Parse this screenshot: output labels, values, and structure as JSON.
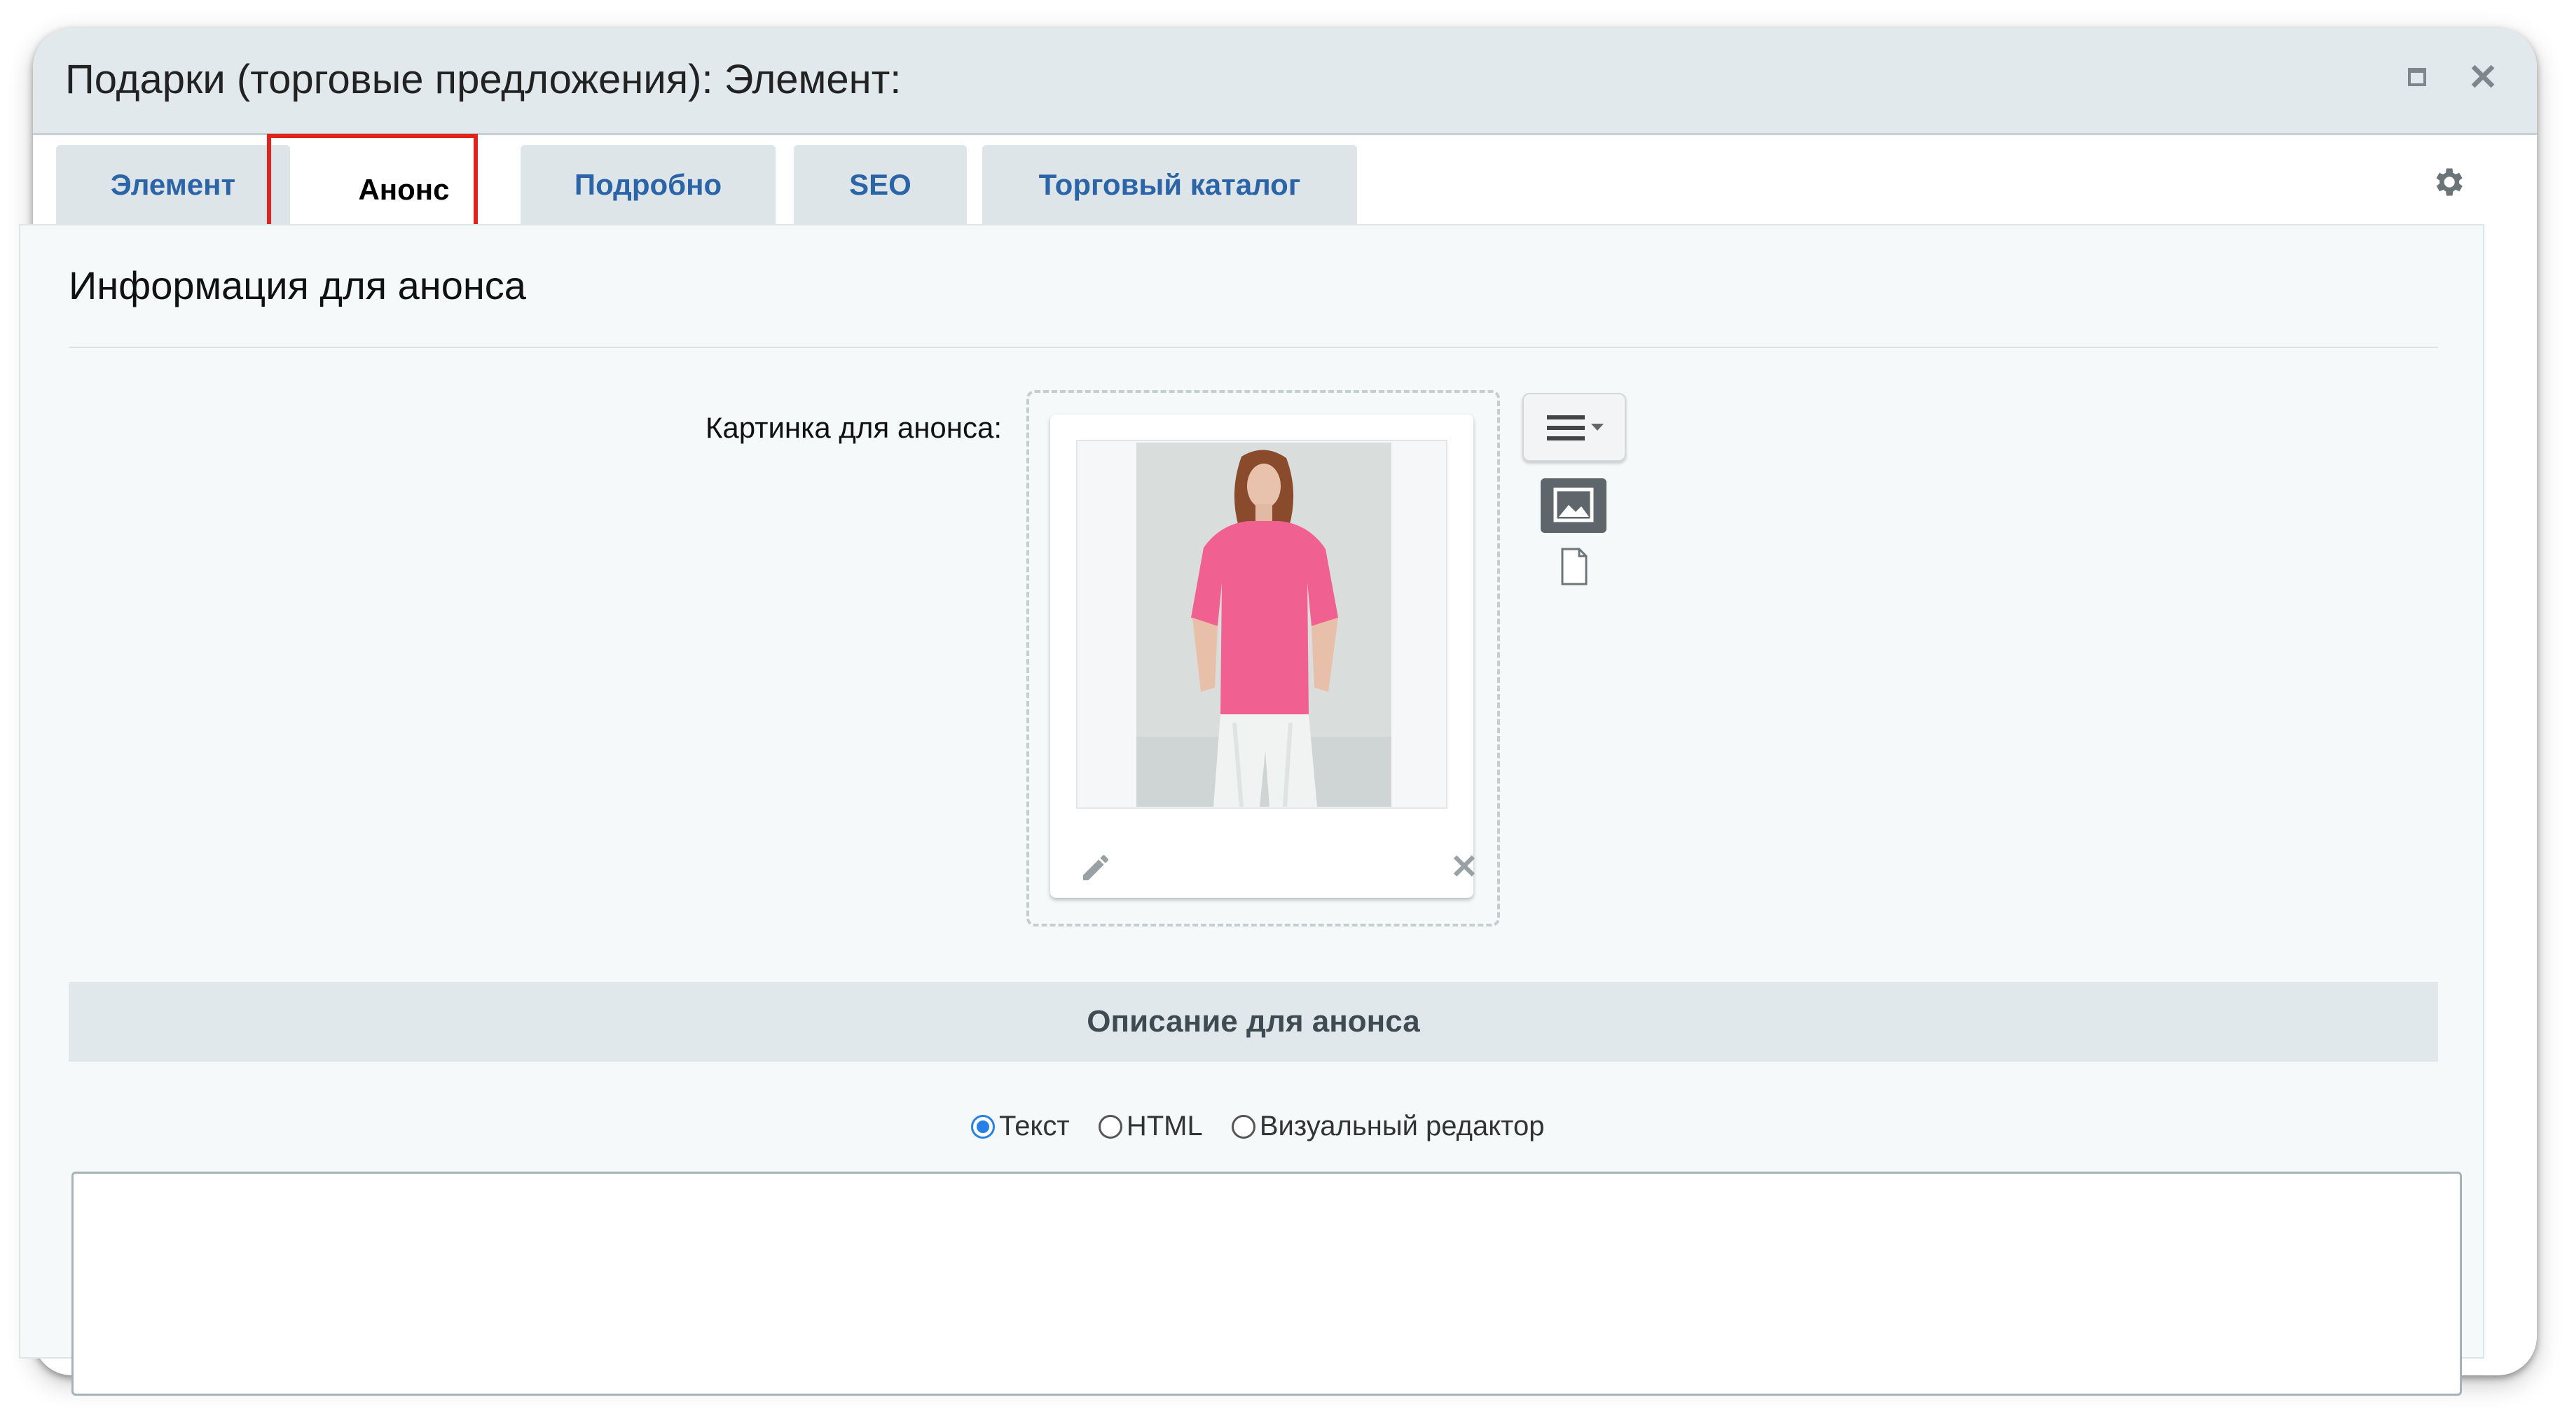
{
  "window": {
    "title": "Подарки (торговые предложения): Элемент:",
    "maximize_icon": "maximize-icon",
    "close_icon": "close-icon",
    "close_glyph": "✕"
  },
  "tabs": [
    {
      "label": "Элемент",
      "active": false
    },
    {
      "label": "Анонс",
      "active": true
    },
    {
      "label": "Подробно",
      "active": false
    },
    {
      "label": "SEO",
      "active": false
    },
    {
      "label": "Торговый каталог",
      "active": false
    }
  ],
  "settings_icon": "gear-icon",
  "section": {
    "title": "Информация для анонса",
    "picture_label": "Картинка для анонса:",
    "picture_alt": "Женщина в розовой футболке",
    "picture_actions": {
      "edit_icon": "pencil-icon",
      "remove_icon": "close-icon",
      "remove_glyph": "✕"
    },
    "side_buttons": {
      "menu_icon": "hamburger-menu-icon",
      "image_icon": "image-icon",
      "file_icon": "file-icon"
    }
  },
  "description": {
    "header": "Описание для анонса",
    "modes": [
      {
        "label": "Текст",
        "checked": true
      },
      {
        "label": "HTML",
        "checked": false
      },
      {
        "label": "Визуальный редактор",
        "checked": false
      }
    ],
    "value": ""
  },
  "colors": {
    "accent": "#2c64a8",
    "highlight": "#e0231b",
    "radio_checked": "#2680e8"
  }
}
